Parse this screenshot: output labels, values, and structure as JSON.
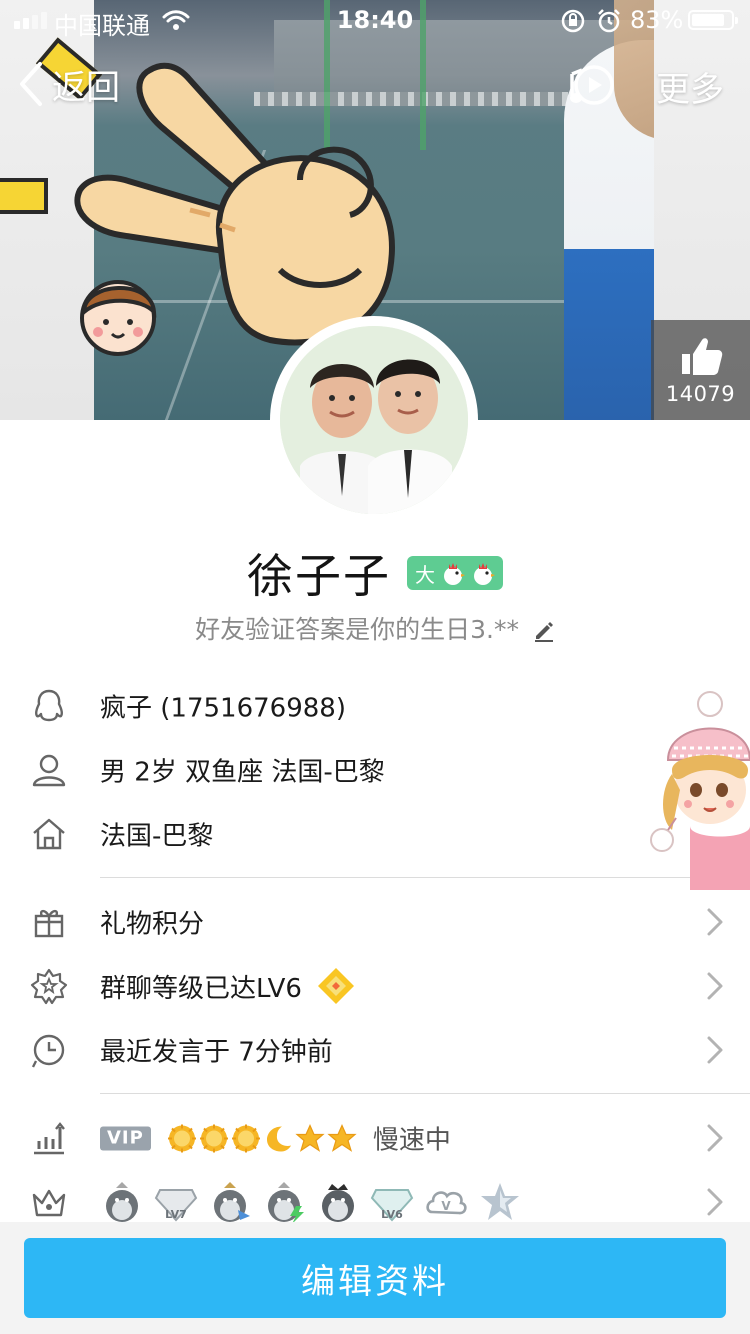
{
  "status_bar": {
    "carrier": "中国联通",
    "time": "18:40",
    "battery_percent": "83%",
    "battery_level": 0.83
  },
  "nav": {
    "back_label": "返回",
    "more_label": "更多",
    "music_icon": "music-play-icon"
  },
  "cover": {
    "like_count": "14079",
    "like_icon": "thumbs-up-icon"
  },
  "profile": {
    "name": "徐子子",
    "level_badge_char": "大",
    "level_badge_color": "#5ecc92",
    "signature": "好友验证答案是你的生日3.**",
    "signature_icon": "pencil-icon"
  },
  "info": {
    "qq": "疯子 (1751676988)",
    "personal": "男 2岁 双鱼座 法国-巴黎",
    "hometown": "法国-巴黎",
    "gift": "礼物积分",
    "group_level": "群聊等级已达LV6",
    "last_message": "最近发言于 7分钟前",
    "vip_tag": "VIP",
    "vip_status": "慢速中",
    "badge_labels": [
      "LV7",
      "LV6",
      "V"
    ]
  },
  "actions": {
    "edit_label": "编辑资料",
    "accent_color": "#2db7f5"
  }
}
